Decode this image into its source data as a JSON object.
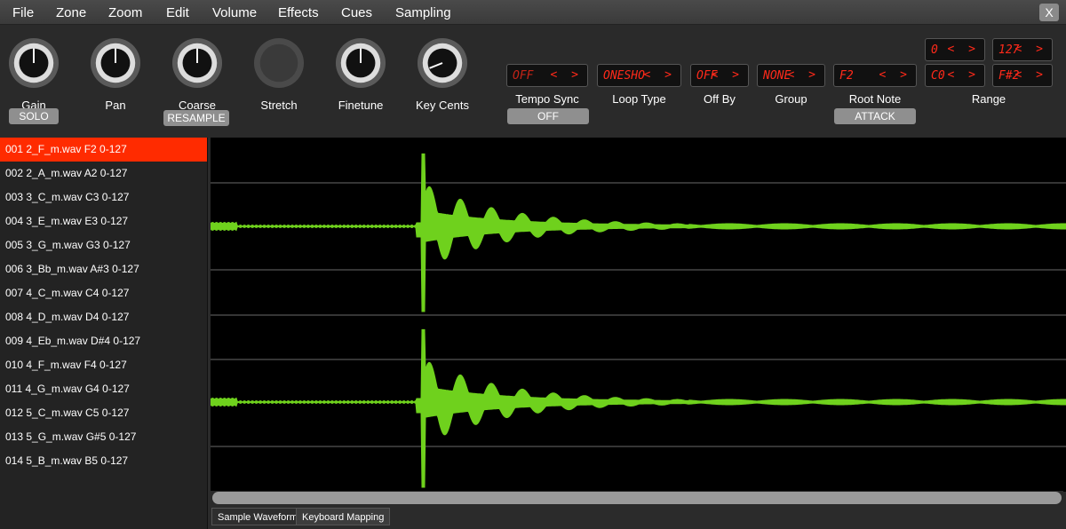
{
  "menu": [
    "File",
    "Zone",
    "Zoom",
    "Edit",
    "Volume",
    "Effects",
    "Cues",
    "Sampling"
  ],
  "close_label": "X",
  "knobs": [
    {
      "label": "Gain",
      "button": "SOLO"
    },
    {
      "label": "Pan"
    },
    {
      "label": "Coarse",
      "button": "RESAMPLE"
    },
    {
      "label": "Stretch"
    },
    {
      "label": "Finetune"
    },
    {
      "label": "Key Cents"
    }
  ],
  "params": {
    "tempo_sync": {
      "value": "OFF",
      "label": "Tempo Sync",
      "button": "OFF"
    },
    "loop_type": {
      "value": "ONESHO",
      "label": "Loop Type"
    },
    "off_by": {
      "value": "OFF",
      "label": "Off By"
    },
    "group": {
      "value": "NONE",
      "label": "Group"
    },
    "root_note": {
      "value": "F2",
      "label": "Root Note",
      "button": "ATTACK"
    },
    "range": {
      "label": "Range",
      "vel_low": "0",
      "vel_high": "127",
      "key_low": "C0",
      "key_high": "F#2"
    }
  },
  "arrows": "< >",
  "samples": [
    "001 2_F_m.wav F2 0-127",
    "002 2_A_m.wav A2 0-127",
    "003 3_C_m.wav C3 0-127",
    "004 3_E_m.wav E3 0-127",
    "005 3_G_m.wav G3 0-127",
    "006 3_Bb_m.wav A#3 0-127",
    "007 4_C_m.wav C4 0-127",
    "008 4_D_m.wav D4 0-127",
    "009 4_Eb_m.wav D#4 0-127",
    "010 4_F_m.wav F4 0-127",
    "011 4_G_m.wav G4 0-127",
    "012 5_C_m.wav C5 0-127",
    "013 5_G_m.wav G#5 0-127",
    "014 5_B_m.wav B5 0-127"
  ],
  "selected_sample": 0,
  "tabs": [
    "Sample Waveform",
    "Keyboard Mapping"
  ],
  "colors": {
    "accent": "#ff2b00",
    "lcd_text": "#ff2a1a",
    "waveform": "#6fd11d"
  }
}
